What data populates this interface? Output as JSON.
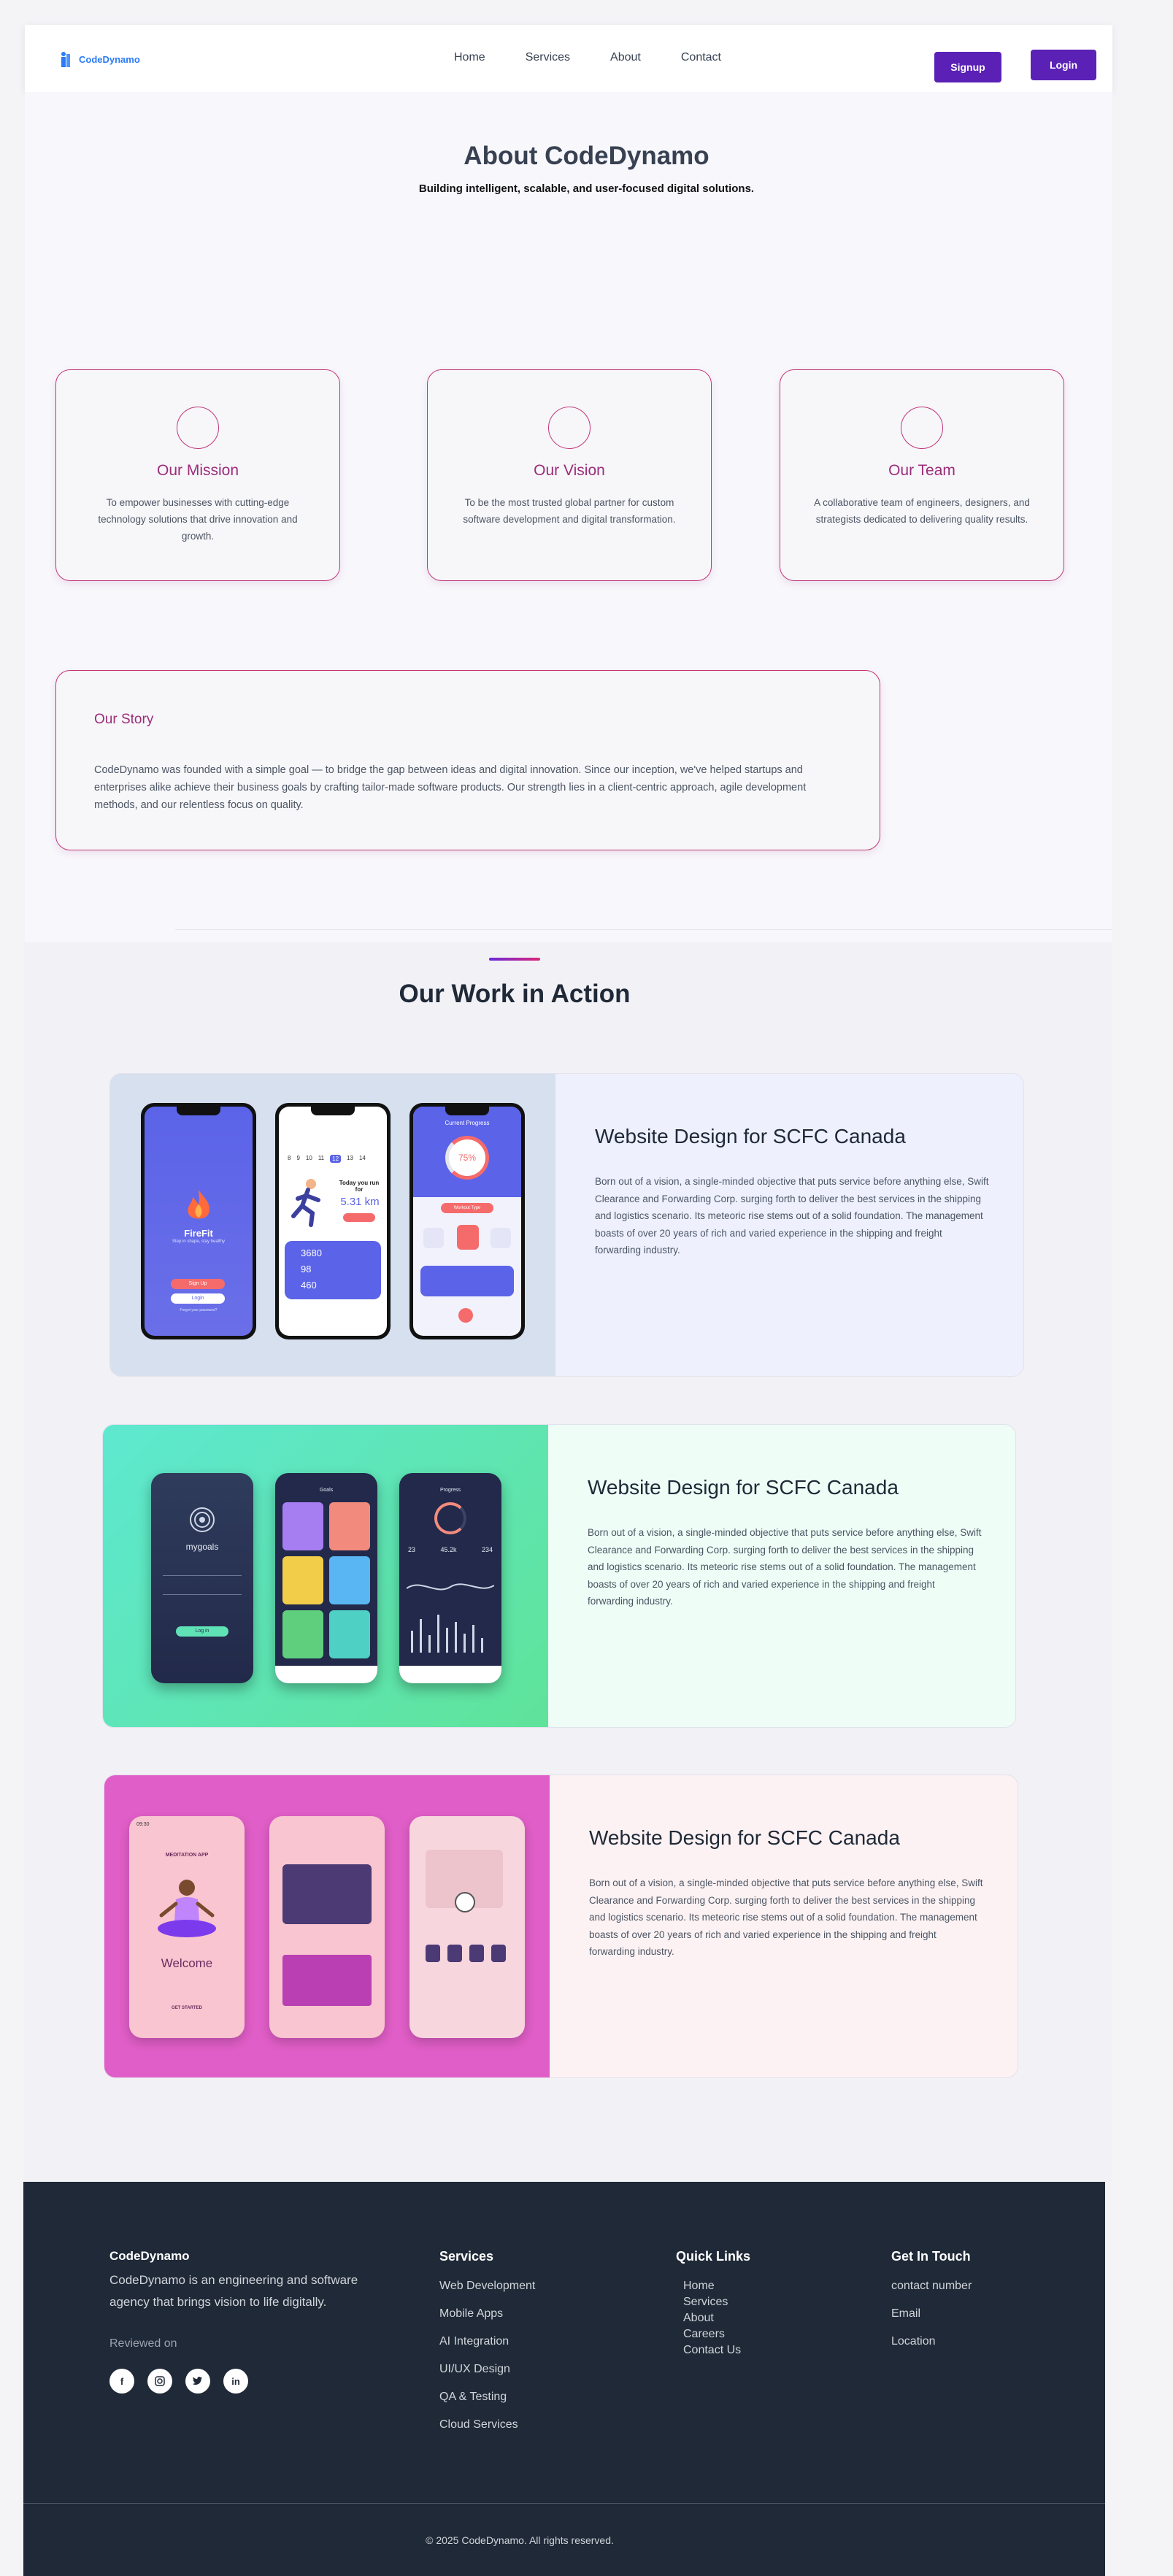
{
  "navbar": {
    "logo_text": "CodeDynamo",
    "links": [
      "Home",
      "Services",
      "About",
      "Contact"
    ],
    "signup_label": "Signup",
    "login_label": "Login"
  },
  "about": {
    "title": "About CodeDynamo",
    "subtitle": "Building intelligent, scalable, and user-focused digital solutions.",
    "cards": [
      {
        "title": "Our Mission",
        "text": "To empower businesses with cutting-edge technology solutions that drive innovation and growth."
      },
      {
        "title": "Our Vision",
        "text": "To be the most trusted global partner for custom software development and digital transformation."
      },
      {
        "title": "Our Team",
        "text": "A collaborative team of engineers, designers, and strategists dedicated to delivering quality results."
      }
    ],
    "story": {
      "title": "Our Story",
      "text": "CodeDynamo was founded with a simple goal — to bridge the gap between ideas and digital innovation. Since our inception, we've helped startups and enterprises alike achieve their business goals by crafting tailor-made software products. Our strength lies in a client-centric approach, agile development methods, and our relentless focus on quality."
    }
  },
  "work": {
    "title": "Our Work in Action",
    "projects": [
      {
        "title": "Website Design for SCFC Canada",
        "text": "Born out of a vision, a single-minded objective that puts service before anything else, Swift Clearance and Forwarding Corp. surging forth to deliver the best services in the shipping and logistics scenario. Its meteoric rise stems out of a solid foundation. The management boasts of over 20 years of rich and varied experience in the shipping and freight forwarding industry."
      },
      {
        "title": "Website Design for SCFC Canada",
        "text": "Born out of a vision, a single-minded objective that puts service before anything else, Swift Clearance and Forwarding Corp. surging forth to deliver the best services in the shipping and logistics scenario. Its meteoric rise stems out of a solid foundation. The management boasts of over 20 years of rich and varied experience in the shipping and freight forwarding industry."
      },
      {
        "title": "Website Design for SCFC Canada",
        "text": "Born out of a vision, a single-minded objective that puts service before anything else, Swift Clearance and Forwarding Corp. surging forth to deliver the best services in the shipping and logistics scenario. Its meteoric rise stems out of a solid foundation. The management boasts of over 20 years of rich and varied experience in the shipping and freight forwarding industry."
      }
    ],
    "mockups": {
      "firefit": {
        "brand": "FireFit",
        "tagline": "Step in shape, stay healthy",
        "signup": "Sign Up",
        "login": "Login",
        "forgot": "Forgot your password?",
        "progress_title": "Current Progress",
        "progress_value": "75%",
        "workout_btn": "Workout Type",
        "run_label": "Today you run for",
        "run_km": "5.31 km",
        "steps": "3680",
        "heart": "98",
        "cal": "460",
        "days": [
          "8",
          "9",
          "10",
          "11",
          "12",
          "13",
          "14"
        ]
      },
      "mygoals": {
        "brand": "mygoals",
        "signin": "Log in",
        "goals_title": "Goals",
        "progress_title": "Progress",
        "stat1": "23",
        "stat2": "45.2k",
        "stat3": "234"
      },
      "meditation": {
        "time": "09:30",
        "app_name": "MEDITATION APP",
        "welcome": "Welcome",
        "get_started": "GET STARTED"
      }
    },
    "colors": {
      "proj1_bg": "#eef0fd",
      "proj1_img": "#d7e0ee",
      "proj2_bg": "#eefdf6",
      "proj3_bg": "#fdf2f3",
      "proj3_img": "#e05ec7"
    }
  },
  "footer": {
    "brand": "CodeDynamo",
    "description": "CodeDynamo is an engineering and software agency that brings vision to life digitally.",
    "reviewed_on": "Reviewed on",
    "social_icons": [
      "facebook-icon",
      "instagram-icon",
      "twitter-icon",
      "linkedin-icon"
    ],
    "services_title": "Services",
    "services": [
      "Web Development",
      "Mobile Apps",
      "AI Integration",
      "UI/UX Design",
      "QA & Testing",
      "Cloud Services"
    ],
    "quick_links_title": "Quick Links",
    "quick_links": [
      "Home",
      "Services",
      "About",
      "Careers",
      "Contact Us"
    ],
    "contact_title": "Get In Touch",
    "contact": [
      "contact number",
      "Email",
      "Location"
    ],
    "copyright": "© 2025 CodeDynamo. All rights reserved."
  }
}
